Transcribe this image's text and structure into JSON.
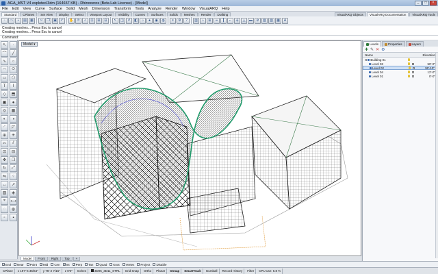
{
  "window": {
    "title": "AGA_MST V4 exploted.3dm (164657 KB) - Rhinoceros (Beta Lab License) - [Model]",
    "minimize": "_",
    "maximize": "□",
    "close": "×"
  },
  "menu": [
    "File",
    "Edit",
    "View",
    "Curve",
    "Surface",
    "Solid",
    "Mesh",
    "Dimension",
    "Transform",
    "Tools",
    "Analyze",
    "Render",
    "Window",
    "VisualARQ",
    "Help"
  ],
  "toolbar_tabs": [
    "Standard",
    "CPlanes",
    "Set View",
    "Display",
    "Select",
    "Viewport Layout",
    "Visibility",
    "Curves",
    "Surfaces",
    "Solids",
    "Meshes",
    "Render",
    "Drafting"
  ],
  "toolbar_tabs_right": [
    "VisualARQ Objects",
    "VisualARQ Documentation",
    "VisualARQ Tools"
  ],
  "command_history": [
    "Creating meshes... Press Esc to cancel",
    "Creating meshes... Press Esc to cancel"
  ],
  "command_prompt": "Command:",
  "viewport": {
    "label": "Model ▾"
  },
  "view_tabs": [
    "Model",
    "Front",
    "Right",
    "Top",
    "+"
  ],
  "right_panel": {
    "tabs": [
      "Levels",
      "Properties",
      "Layers"
    ],
    "tab_colors": [
      "#2f7a3a",
      "#c08a2e",
      "#c44a3a"
    ],
    "columns": {
      "name": "Name",
      "elevation": "Elevation"
    },
    "levels": [
      {
        "name": "Building 01",
        "elevation": "",
        "indent": 0,
        "selected": false
      },
      {
        "name": "Level 03",
        "elevation": "50'-0\"",
        "indent": 1,
        "selected": false
      },
      {
        "name": "Level 02",
        "elevation": "36'-10\"",
        "indent": 1,
        "selected": true
      },
      {
        "name": "Level 04",
        "elevation": "12'-0\"",
        "indent": 1,
        "selected": false
      },
      {
        "name": "Level 01",
        "elevation": "0'-0\"",
        "indent": 1,
        "selected": false
      }
    ]
  },
  "osnaps": [
    {
      "label": "End",
      "checked": true
    },
    {
      "label": "Near",
      "checked": false
    },
    {
      "label": "Point",
      "checked": false
    },
    {
      "label": "Mid",
      "checked": true
    },
    {
      "label": "Cen",
      "checked": false
    },
    {
      "label": "Int",
      "checked": true
    },
    {
      "label": "Perp",
      "checked": true
    },
    {
      "label": "Tan",
      "checked": false
    },
    {
      "label": "Quad",
      "checked": false
    },
    {
      "label": "Knot",
      "checked": false
    },
    {
      "label": "Vertex",
      "checked": false
    },
    {
      "label": "Project",
      "checked": false
    },
    {
      "label": "Disable",
      "checked": false
    }
  ],
  "status": {
    "cplane": "CPlane",
    "x": "x 197'-6 35/64\"",
    "y": "y 76'-2 7/16\"",
    "z": "z 0'0\"",
    "units": "Inches",
    "layer": "3D05_3D11_STRL",
    "items": [
      "Grid Snap",
      "Ortho",
      "Planar",
      "Osnap",
      "SmartTrack",
      "Gumball",
      "Record History",
      "Filter"
    ],
    "bold_items": [
      "Osnap",
      "SmartTrack"
    ],
    "cpu": "CPU use: 6.8 %"
  }
}
